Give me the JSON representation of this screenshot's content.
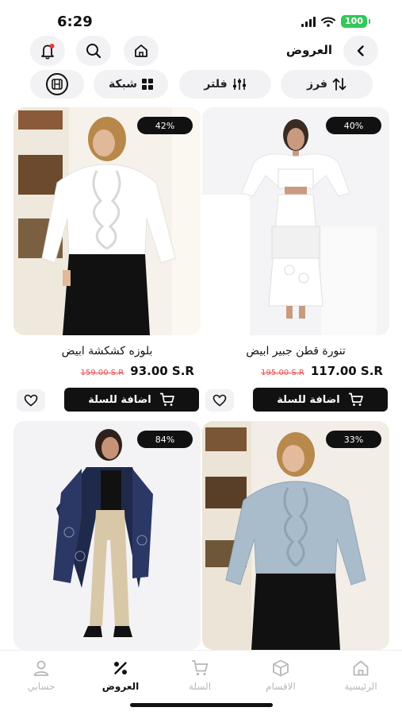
{
  "status_bar": {
    "time": "6:29",
    "battery": "100"
  },
  "header": {
    "title": "العروض",
    "icons": [
      "chevron-left-icon",
      "home-icon",
      "search-icon",
      "bell-icon"
    ]
  },
  "filters": {
    "sort_label": "فرز",
    "filter_label": "فلتر",
    "grid_label": "شبكة"
  },
  "products": [
    {
      "name": "تنورة قطن جبير ابيض",
      "price": "117.00 S.R",
      "old_price": "195.00 S.R",
      "discount": "40%",
      "add_to_cart": "اضافة للسلة"
    },
    {
      "name": "بلوزه كشكشة ابيض",
      "price": "93.00 S.R",
      "old_price": "159.00 S.R",
      "discount": "42%",
      "add_to_cart": "اضافة للسلة"
    },
    {
      "discount": "33%"
    },
    {
      "discount": "84%"
    }
  ],
  "tabs": [
    {
      "label": "الرئيسية",
      "icon": "home-icon"
    },
    {
      "label": "الاقسام",
      "icon": "box-icon"
    },
    {
      "label": "السلة",
      "icon": "cart-icon"
    },
    {
      "label": "العروض",
      "icon": "percent-icon",
      "active": true
    },
    {
      "label": "حسابي",
      "icon": "user-icon"
    }
  ],
  "colors": {
    "accent": "#111111",
    "discount_old": "#e55353",
    "chip_bg": "#f2f2f4",
    "battery": "#34c759",
    "notification_dot": "#e53935"
  }
}
